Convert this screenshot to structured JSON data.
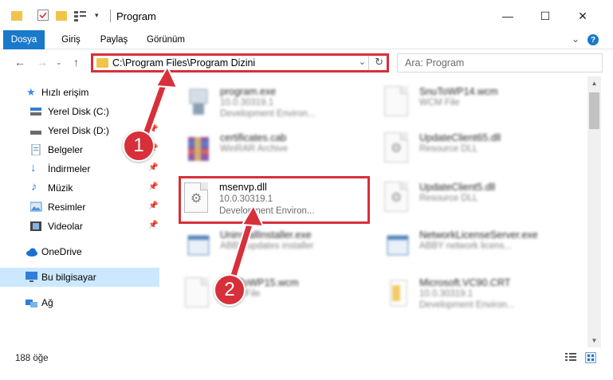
{
  "window": {
    "title": "Program",
    "minimize": "—",
    "maximize": "☐",
    "close": "✕"
  },
  "ribbon": {
    "tabs": [
      {
        "label": "Dosya",
        "active": true
      },
      {
        "label": "Giriş"
      },
      {
        "label": "Paylaş"
      },
      {
        "label": "Görünüm"
      }
    ]
  },
  "address": {
    "path": "C:\\Program Files\\Program Dizini",
    "search_placeholder": "Ara: Program"
  },
  "sidebar": {
    "items": [
      {
        "label": "Hızlı erişim",
        "icon": "star-icon",
        "color": "#3a8ee6"
      },
      {
        "label": "Yerel Disk (C:)",
        "icon": "disk-icon",
        "color": "#5a5a5a",
        "pinned": true
      },
      {
        "label": "Yerel Disk (D:)",
        "icon": "disk-icon",
        "color": "#5a5a5a",
        "pinned": true
      },
      {
        "label": "Belgeler",
        "icon": "documents-icon",
        "color": "#6b8cb8",
        "pinned": true
      },
      {
        "label": "İndirmeler",
        "icon": "downloads-icon",
        "color": "#2f7fd6",
        "pinned": true
      },
      {
        "label": "Müzik",
        "icon": "music-icon",
        "color": "#2f7fd6",
        "pinned": true
      },
      {
        "label": "Resimler",
        "icon": "pictures-icon",
        "color": "#4a90d9",
        "pinned": true
      },
      {
        "label": "Videolar",
        "icon": "videos-icon",
        "color": "#444444",
        "pinned": true
      },
      {
        "label": "OneDrive",
        "icon": "onedrive-icon",
        "color": "#1e6fd0"
      },
      {
        "label": "Bu bilgisayar",
        "icon": "computer-icon",
        "color": "#2f7fd6",
        "selected": true
      },
      {
        "label": "Ağ",
        "icon": "network-icon",
        "color": "#2f7fd6"
      }
    ]
  },
  "files": {
    "left": [
      {
        "name": "program.exe",
        "line1": "10.0.30319.1",
        "line2": "Development Environ...",
        "icon": "exe-icon"
      },
      {
        "name": "certificates.cab",
        "line1": "WinRAR Archive",
        "line2": "",
        "icon": "winrar-icon"
      },
      {
        "name": "msenvp.dll",
        "line1": "10.0.30319.1",
        "line2": "Development Environ...",
        "icon": "dll-gear-icon",
        "highlighted": true
      },
      {
        "name": "UninstallInstaller.exe",
        "line1": "ABBY updates installer",
        "line2": "",
        "icon": "installer-icon"
      },
      {
        "name": "SnuToWP15.wcm",
        "line1": "WCM File",
        "line2": "",
        "icon": "document-icon"
      }
    ],
    "right": [
      {
        "name": "SnuToWP14.wcm",
        "line1": "WCM File",
        "line2": "",
        "icon": "document-icon"
      },
      {
        "name": "UpdateClient65.dll",
        "line1": "Resource DLL",
        "line2": "",
        "icon": "dll-gear-icon"
      },
      {
        "name": "UpdateClient5.dll",
        "line1": "Resource DLL",
        "line2": "",
        "icon": "dll-gear-icon"
      },
      {
        "name": "NetworkLicenseServer.exe",
        "line1": "ABBY network licens...",
        "line2": "",
        "icon": "installer-icon"
      },
      {
        "name": "Microsoft.VC90.CRT",
        "line1": "10.0.30319.1",
        "line2": "Development Environ...",
        "icon": "folder-doc-icon"
      }
    ]
  },
  "status": {
    "item_count": "188 öğe"
  },
  "callouts": {
    "one": "1",
    "two": "2"
  },
  "colors": {
    "accent": "#1979ca",
    "highlight": "#d7303a",
    "selection": "#cce8ff"
  }
}
